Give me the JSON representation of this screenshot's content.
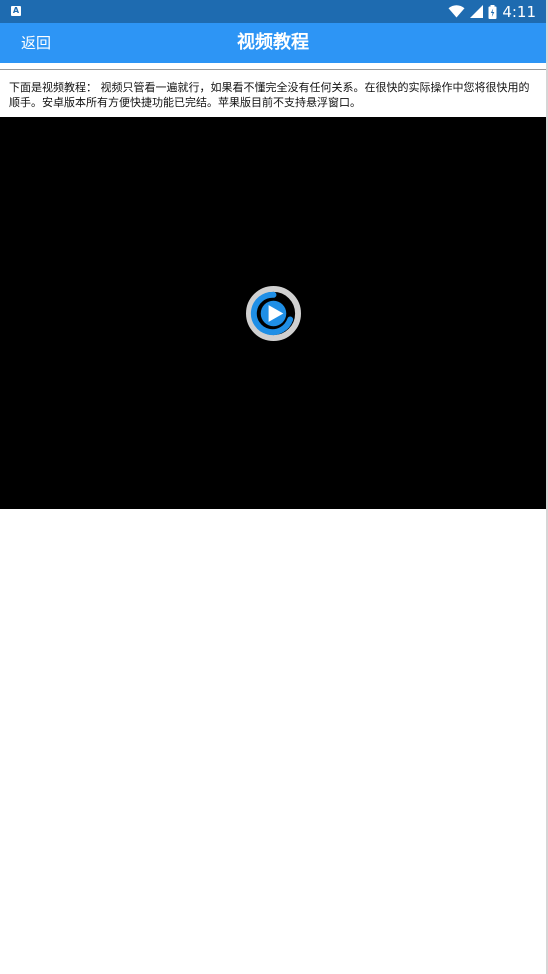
{
  "status_bar": {
    "time": "4:11",
    "icons": [
      "notification-app-icon",
      "wifi-icon",
      "cell-signal-icon",
      "battery-icon"
    ]
  },
  "header": {
    "back_label": "返回",
    "title": "视频教程"
  },
  "intro": {
    "text": "下面是视频教程： 视频只管看一遍就行，如果看不懂完全没有任何关系。在很快的实际操作中您将很快用的顺手。安卓版本所有方便快捷功能已完结。苹果版目前不支持悬浮窗口。"
  },
  "video": {
    "icon": "play-icon"
  },
  "colors": {
    "status_bar": "#1e6bb0",
    "app_bar": "#2d95f5",
    "video_background": "#000000",
    "play_ring": "#d0d0d0",
    "play_accent": "#1f8fe6"
  }
}
